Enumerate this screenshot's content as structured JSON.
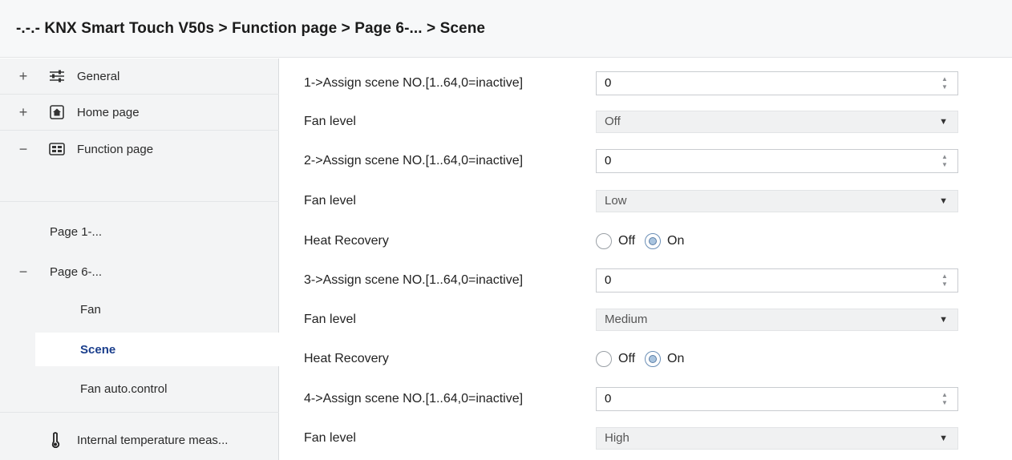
{
  "breadcrumb": "-.-.- KNX Smart Touch V50s > Function page > Page 6-... > Scene",
  "sidebar": {
    "items": [
      {
        "label": "General",
        "expander": "+",
        "icon": "sliders-icon"
      },
      {
        "label": "Home page",
        "expander": "+",
        "icon": "home-icon"
      },
      {
        "label": "Function page",
        "expander": "−",
        "icon": "grid-icon"
      },
      {
        "label": "Page 1-..."
      },
      {
        "label": "Page 6-...",
        "expander": "−"
      },
      {
        "label": "Fan"
      },
      {
        "label": "Scene"
      },
      {
        "label": "Fan auto.control"
      },
      {
        "label": "Internal temperature meas...",
        "icon": "thermometer-icon"
      }
    ]
  },
  "params": {
    "scene1_label": "1->Assign scene NO.[1..64,0=inactive]",
    "scene1_value": "0",
    "fan1_label": "Fan level",
    "fan1_value": "Off",
    "scene2_label": "2->Assign scene NO.[1..64,0=inactive]",
    "scene2_value": "0",
    "fan2_label": "Fan level",
    "fan2_value": "Low",
    "heat2_label": "Heat Recovery",
    "scene3_label": "3->Assign scene NO.[1..64,0=inactive]",
    "scene3_value": "0",
    "fan3_label": "Fan level",
    "fan3_value": "Medium",
    "heat3_label": "Heat Recovery",
    "scene4_label": "4->Assign scene NO.[1..64,0=inactive]",
    "scene4_value": "0",
    "fan4_label": "Fan level",
    "fan4_value": "High"
  },
  "radio_options": {
    "off": "Off",
    "on": "On",
    "selected": "On"
  },
  "colors": {
    "selected_text": "#1a3e8c",
    "radio_selected": "#a9c4df"
  }
}
